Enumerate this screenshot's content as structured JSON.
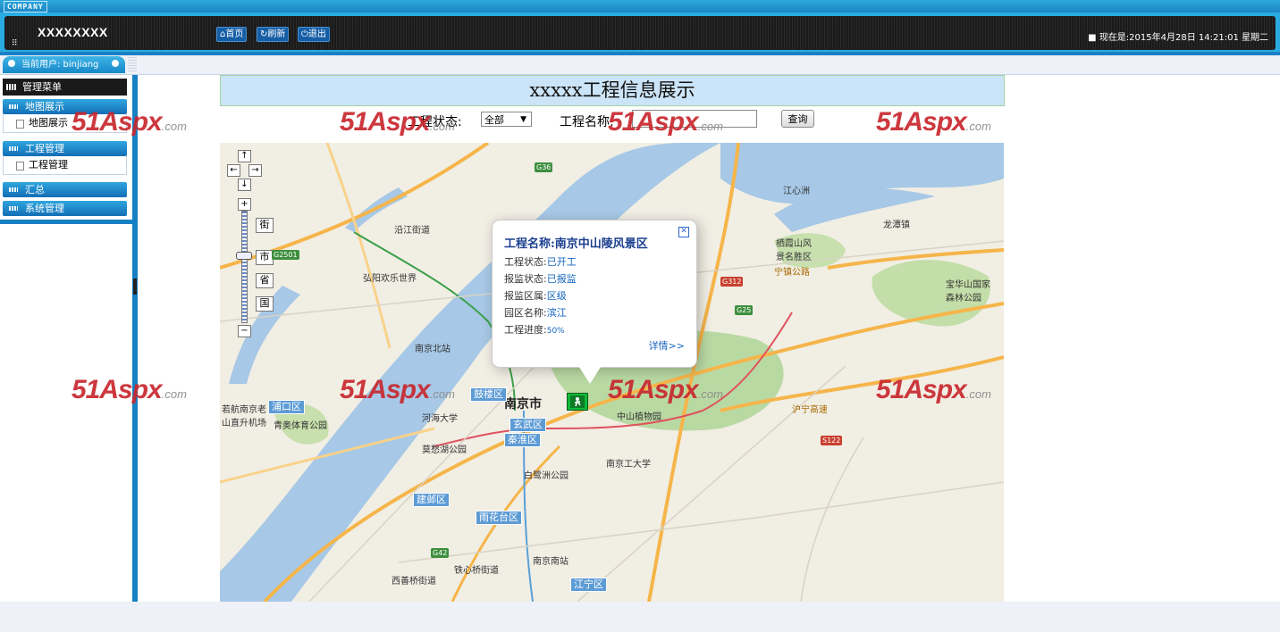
{
  "header": {
    "company": "COMPANY",
    "app_name": "XXXXXXXX",
    "nav": [
      "首页",
      "刷新",
      "退出"
    ],
    "clock": "现在是:2015年4月28日 14:21:01 星期二"
  },
  "user": {
    "label": "当前用户: binjiang"
  },
  "sidebar": {
    "title": "管理菜单",
    "groups": [
      {
        "label": "地图展示",
        "items": [
          "地图展示"
        ]
      },
      {
        "label": "工程管理",
        "items": [
          "工程管理"
        ]
      },
      {
        "label": "汇总",
        "items": []
      },
      {
        "label": "系统管理",
        "items": []
      }
    ]
  },
  "main": {
    "title": "xxxxx工程信息展示",
    "filter": {
      "status_label": "工程状态:",
      "status_value": "全部",
      "name_label": "工程名称:",
      "name_value": "",
      "query_button": "查询"
    }
  },
  "map": {
    "zoom_levels": [
      "街",
      "市",
      "省",
      "国"
    ],
    "popup": {
      "title": "工程名称:南京中山陵风景区",
      "rows": [
        {
          "k": "工程状态:",
          "v": "已开工"
        },
        {
          "k": "报监状态:",
          "v": "已报监"
        },
        {
          "k": "报监区属:",
          "v": "区级"
        },
        {
          "k": "园区名称:",
          "v": "滨江"
        },
        {
          "k": "工程进度:",
          "v": "50%"
        }
      ],
      "detail": "详情>>"
    },
    "districts": [
      "浦口区",
      "鼓楼区",
      "玄武区",
      "秦淮区",
      "建邺区",
      "雨花台区",
      "江宁区"
    ],
    "places": [
      "南京市",
      "江心洲",
      "龙潭镇",
      "沿江街道",
      "弘阳欢乐世界",
      "南京北站",
      "河海大学",
      "莫愁湖公园",
      "白鹭洲公园",
      "南京工大学",
      "中山植物园",
      "栖霞山风景名胜区",
      "宝华山国家森林公园",
      "青奥体育公园",
      "西善桥街道",
      "铁心桥街道",
      "南京南站",
      "宁镇公路",
      "沪宁高速",
      "若航南京老山直升机场"
    ],
    "roads": [
      "G36",
      "G2501",
      "G312",
      "G25",
      "S122",
      "G42"
    ]
  },
  "watermark": {
    "brand": "51Aspx",
    "suffix": ".com"
  },
  "colors": {
    "accent": "#29abe2",
    "dark": "#1a1a1a",
    "title_bg": "#cce4f7",
    "watermark": "#c8282e"
  }
}
